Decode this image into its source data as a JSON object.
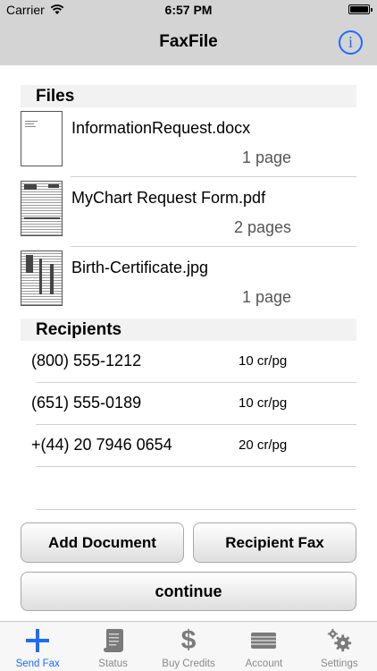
{
  "status_bar": {
    "carrier": "Carrier",
    "time": "6:57 PM"
  },
  "nav": {
    "title": "FaxFile",
    "info_icon": "info-icon"
  },
  "files": {
    "header": "Files",
    "items": [
      {
        "name": "InformationRequest.docx",
        "pages": "1 page"
      },
      {
        "name": "MyChart Request Form.pdf",
        "pages": "2 pages"
      },
      {
        "name": "Birth-Certificate.jpg",
        "pages": "1 page"
      }
    ]
  },
  "recipients": {
    "header": "Recipients",
    "items": [
      {
        "number": "(800) 555-1212",
        "rate": "10 cr/pg"
      },
      {
        "number": "(651) 555-0189",
        "rate": "10 cr/pg"
      },
      {
        "number": "+(44) 20 7946 0654",
        "rate": "20 cr/pg"
      }
    ]
  },
  "buttons": {
    "add_document": "Add Document",
    "recipient_fax": "Recipient Fax",
    "continue": "continue"
  },
  "tabs": [
    {
      "label": "Send Fax",
      "icon": "plus-icon",
      "active": true
    },
    {
      "label": "Status",
      "icon": "scroll-icon",
      "active": false
    },
    {
      "label": "Buy Credits",
      "icon": "dollar-icon",
      "active": false
    },
    {
      "label": "Account",
      "icon": "card-icon",
      "active": false
    },
    {
      "label": "Settings",
      "icon": "gears-icon",
      "active": false
    }
  ],
  "colors": {
    "accent": "#1a6dff",
    "bar": "#d4d4d4",
    "section": "#f2f2f2"
  }
}
